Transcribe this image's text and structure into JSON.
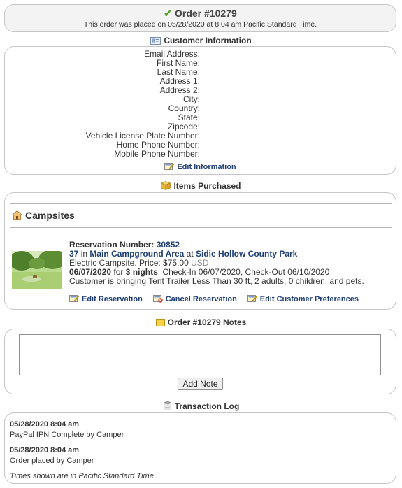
{
  "order": {
    "title": "Order #10279",
    "placed_text": "This order was placed on 05/28/2020 at 8:04 am Pacific Standard Time."
  },
  "customer": {
    "heading": "Customer Information",
    "fields": [
      "Email Address:",
      "First Name:",
      "Last Name:",
      "Address 1:",
      "Address 2:",
      "City:",
      "Country:",
      "State:",
      "Zipcode:",
      "Vehicle License Plate Number:",
      "Home Phone Number:",
      "Mobile Phone Number:"
    ],
    "edit_label": "Edit Information"
  },
  "items": {
    "heading": "Items Purchased",
    "category": "Campsites",
    "reservation": {
      "number_label": "Reservation Number:",
      "number": "30852",
      "site": "37",
      "in_text": "in",
      "area": "Main Campground Area",
      "at_text": "at",
      "park": "Sidie Hollow County Park",
      "price_line": "Electric Campsite. Price: $75.00",
      "currency": "USD",
      "date": "06/07/2020",
      "for_text": "for",
      "nights": "3 nights",
      "checkin_text": ". Check-In 06/07/2020, Check-Out 06/10/2020",
      "party_text": "Customer is bringing Tent Trailer Less Than 30 ft, 2 adults, 0 children, and pets."
    },
    "actions": {
      "edit": "Edit Reservation",
      "cancel": "Cancel Reservation",
      "prefs": "Edit Customer Preferences"
    }
  },
  "notes": {
    "heading": "Order #10279 Notes",
    "textarea_value": "",
    "add_button": "Add Note"
  },
  "log": {
    "heading": "Transaction Log",
    "entries": [
      {
        "time": "05/28/2020 8:04 am",
        "text": "PayPal IPN Complete by Camper"
      },
      {
        "time": "05/28/2020 8:04 am",
        "text": "Order placed by Camper"
      }
    ],
    "footer": "Times shown are in Pacific Standard Time"
  },
  "colors": {
    "check": "#5aa02c",
    "link": "#1f3f74",
    "border": "#c6c6c6"
  }
}
